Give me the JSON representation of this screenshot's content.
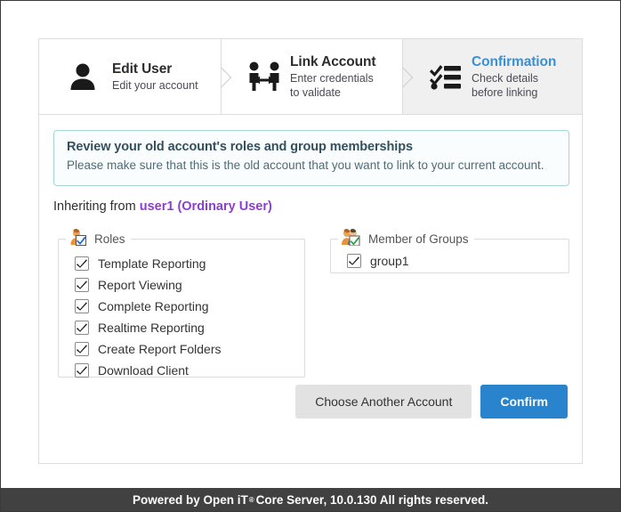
{
  "wizard": {
    "steps": [
      {
        "icon": "user-icon",
        "title": "Edit User",
        "subtitle": "Edit your account",
        "active": false
      },
      {
        "icon": "link-account-icon",
        "title": "Link Account",
        "subtitle": "Enter credentials\nto validate",
        "subtitle_line1": "Enter credentials",
        "subtitle_line2": "to validate",
        "active": false
      },
      {
        "icon": "checklist-icon",
        "title": "Confirmation",
        "subtitle_line1": "Check details",
        "subtitle_line2": "before linking",
        "active": true
      }
    ]
  },
  "banner": {
    "title": "Review your old account's roles and group memberships",
    "subtitle": "Please make sure that this is the old account that you want to link to your current account."
  },
  "inheriting": {
    "prefix": "Inheriting from",
    "account_link": "user1 (Ordinary User)"
  },
  "roles": {
    "legend": "Roles",
    "legend_icon": "user-check-icon",
    "items": [
      {
        "label": "Template Reporting",
        "checked": true
      },
      {
        "label": "Report Viewing",
        "checked": true
      },
      {
        "label": "Complete Reporting",
        "checked": true
      },
      {
        "label": "Realtime Reporting",
        "checked": true
      },
      {
        "label": "Create Report Folders",
        "checked": true
      },
      {
        "label": "Download Client",
        "checked": true
      }
    ]
  },
  "groups": {
    "legend": "Member of Groups",
    "legend_icon": "users-check-icon",
    "items": [
      {
        "label": "group1",
        "checked": true
      }
    ]
  },
  "actions": {
    "secondary_label": "Choose Another Account",
    "primary_label": "Confirm"
  },
  "footer": {
    "text_before": "Powered by Open iT",
    "registered_mark": "®",
    "text_after": "Core Server, 10.0.130 All rights reserved."
  },
  "colors": {
    "accent_blue": "#2a84cd",
    "active_step_blue": "#3b8fd4",
    "link_purple": "#8c3fcf",
    "banner_border": "#a8d4d6",
    "footer_bg": "#414141"
  }
}
